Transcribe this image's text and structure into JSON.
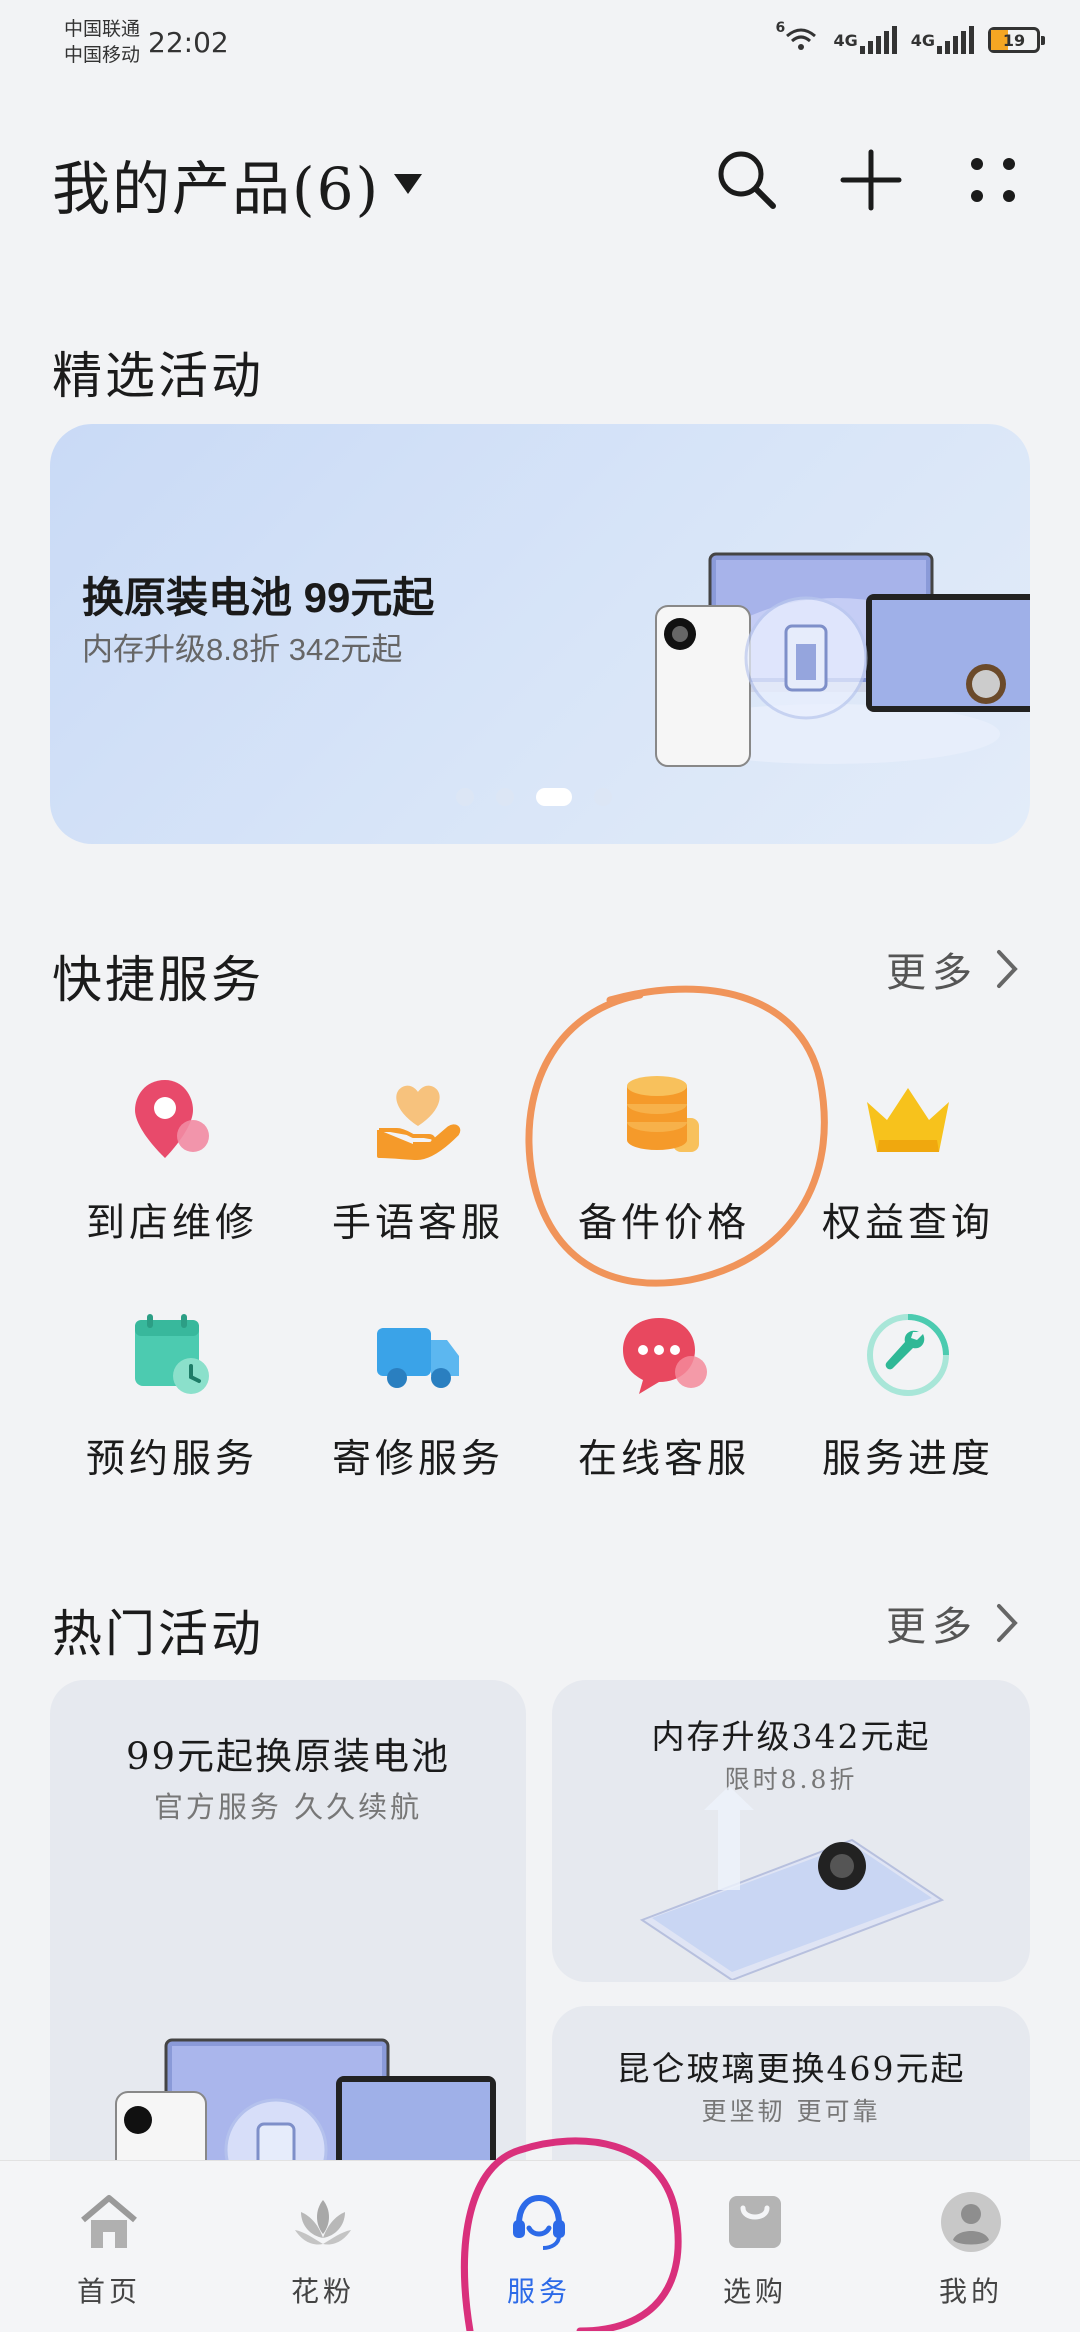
{
  "status_bar": {
    "carrier_1": "中国联通",
    "carrier_2": "中国移动",
    "time": "22:02",
    "net_1": "4G",
    "net_2": "4G",
    "wifi_badge": "6",
    "battery": "19"
  },
  "header": {
    "title": "我的产品(6)",
    "icons": [
      "search-icon",
      "add-icon",
      "more-icon"
    ]
  },
  "featured": {
    "section_title": "精选活动",
    "banner_headline": "换原装电池 99元起",
    "banner_sub": "内存升级8.8折 342元起",
    "carousel_page": 3,
    "carousel_total": 4
  },
  "quick_services": {
    "section_title": "快捷服务",
    "more_label": "更多",
    "items": [
      {
        "label": "到店维修",
        "icon": "location-pin-icon"
      },
      {
        "label": "手语客服",
        "icon": "heart-hand-icon"
      },
      {
        "label": "备件价格",
        "icon": "coin-stack-icon"
      },
      {
        "label": "权益查询",
        "icon": "crown-icon"
      },
      {
        "label": "预约服务",
        "icon": "calendar-clock-icon"
      },
      {
        "label": "寄修服务",
        "icon": "delivery-truck-icon"
      },
      {
        "label": "在线客服",
        "icon": "chat-bubble-icon"
      },
      {
        "label": "服务进度",
        "icon": "wrench-progress-icon"
      }
    ]
  },
  "hot_activities": {
    "section_title": "热门活动",
    "more_label": "更多",
    "cards": [
      {
        "title": "99元起换原装电池",
        "subtitle": "官方服务 久久续航"
      },
      {
        "title": "内存升级342元起",
        "subtitle": "限时8.8折"
      },
      {
        "title": "昆仑玻璃更换469元起",
        "subtitle": "更坚韧 更可靠"
      }
    ]
  },
  "tab_bar": {
    "items": [
      {
        "label": "首页",
        "icon": "home-icon"
      },
      {
        "label": "花粉",
        "icon": "flower-icon"
      },
      {
        "label": "服务",
        "icon": "service-headset-icon"
      },
      {
        "label": "选购",
        "icon": "shopping-bag-icon"
      },
      {
        "label": "我的",
        "icon": "user-avatar-icon"
      }
    ],
    "active": "服务"
  },
  "colors": {
    "background": "#f2f3f5",
    "accent": "#2c6ae8",
    "annotation_orange": "#f0945a",
    "annotation_pink": "#d9307c"
  }
}
